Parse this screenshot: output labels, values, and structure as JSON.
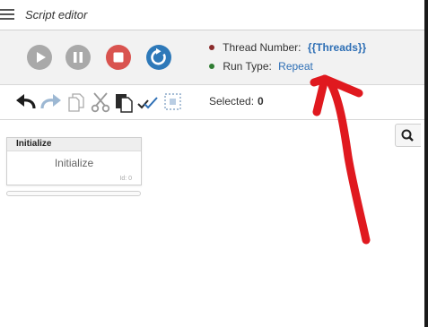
{
  "window": {
    "title": "Script editor"
  },
  "run_controls": {
    "buttons": [
      {
        "name": "play",
        "icon": "play-icon",
        "color": "#a9a9a9"
      },
      {
        "name": "pause",
        "icon": "pause-icon",
        "color": "#a9a9a9"
      },
      {
        "name": "stop",
        "icon": "stop-icon",
        "color": "#d9534f"
      },
      {
        "name": "refresh",
        "icon": "refresh-icon",
        "color": "#2e79b9"
      }
    ],
    "thread_label": "Thread Number:",
    "thread_value": "{{Threads}}",
    "thread_dot_color": "#8b2b2b",
    "run_type_label": "Run Type:",
    "run_type_value": "Repeat",
    "run_type_dot_color": "#2f7d32"
  },
  "toolbar": {
    "tools": [
      "undo-icon",
      "redo-icon",
      "copy-icon",
      "cut-icon",
      "paste-icon",
      "select-all-icon",
      "select-region-icon"
    ],
    "selected_label": "Selected:",
    "selected_count": "0"
  },
  "canvas": {
    "search_icon": "search-icon",
    "node": {
      "header": "Initialize",
      "body": "Initialize",
      "id_text": "Id: 0"
    }
  },
  "annotation": {
    "arrow_color": "#e0191f"
  }
}
